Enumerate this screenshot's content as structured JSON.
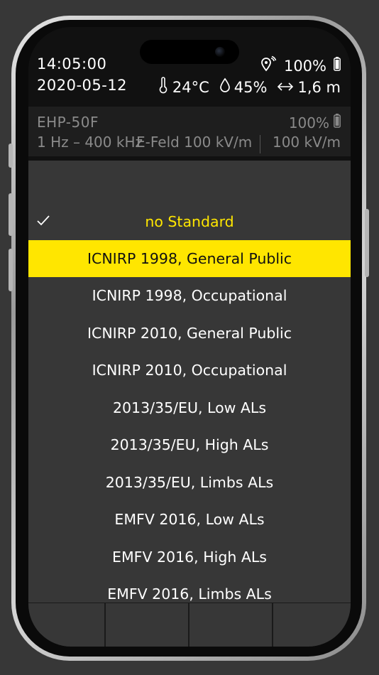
{
  "status": {
    "time": "14:05:00",
    "date": "2020-05-12",
    "battery": "100%",
    "temperature": "24°C",
    "humidity": "45%",
    "distance": "1,6 m",
    "icons": [
      "location-signal-icon",
      "battery-icon",
      "thermometer-icon",
      "droplet-icon",
      "distance-arrows-icon"
    ]
  },
  "device": {
    "name": "EHP-50F",
    "battery": "100%",
    "range": "1 Hz – 400 kHz",
    "field": "E-Feld 100 kV/m",
    "value": "100 kV/m"
  },
  "menu": {
    "items": [
      {
        "label": "no Standard",
        "state": "current"
      },
      {
        "label": "ICNIRP 1998, General Public",
        "state": "highlighted"
      },
      {
        "label": "ICNIRP 1998, Occupational",
        "state": "normal"
      },
      {
        "label": "ICNIRP 2010, General Public",
        "state": "normal"
      },
      {
        "label": "ICNIRP 2010, Occupational",
        "state": "normal"
      },
      {
        "label": "2013/35/EU, Low ALs",
        "state": "normal"
      },
      {
        "label": "2013/35/EU, High ALs",
        "state": "normal"
      },
      {
        "label": "2013/35/EU, Limbs ALs",
        "state": "normal"
      },
      {
        "label": "EMFV 2016, Low ALs",
        "state": "normal"
      },
      {
        "label": "EMFV 2016, High ALs",
        "state": "normal"
      },
      {
        "label": "EMFV 2016, Limbs ALs",
        "state": "normal"
      }
    ]
  },
  "colors": {
    "accent": "#ffe600",
    "background": "#373737",
    "header": "#111111"
  }
}
